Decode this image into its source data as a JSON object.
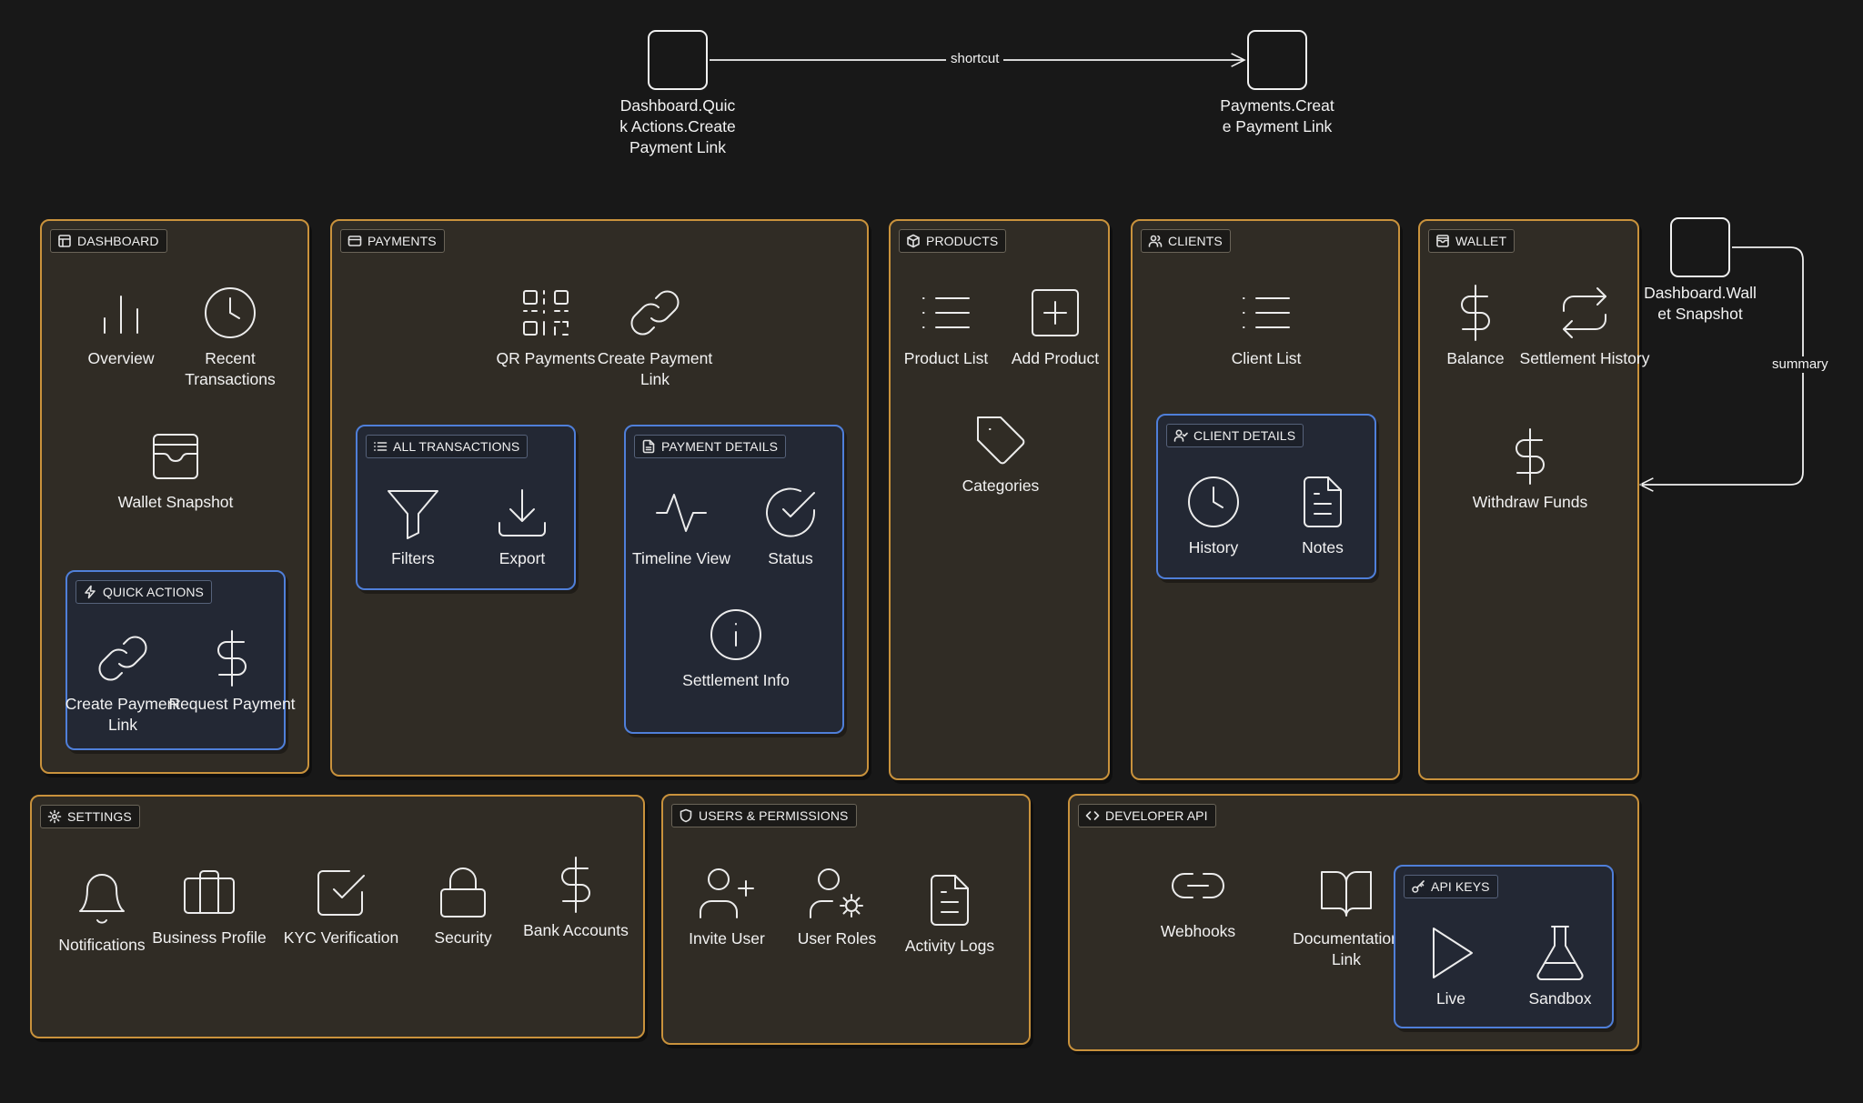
{
  "groups": {
    "dashboard": {
      "label": "DASHBOARD",
      "icon": "layout-icon"
    },
    "quick_actions": {
      "label": "QUICK ACTIONS",
      "icon": "lightning-icon"
    },
    "payments": {
      "label": "PAYMENTS",
      "icon": "card-icon"
    },
    "all_transactions": {
      "label": "ALL TRANSACTIONS",
      "icon": "list-icon"
    },
    "payment_details": {
      "label": "PAYMENT DETAILS",
      "icon": "document-icon"
    },
    "products": {
      "label": "PRODUCTS",
      "icon": "box-icon"
    },
    "clients": {
      "label": "CLIENTS",
      "icon": "users-icon"
    },
    "client_details": {
      "label": "CLIENT DETAILS",
      "icon": "user-check-icon"
    },
    "wallet": {
      "label": "WALLET",
      "icon": "wallet-icon"
    },
    "settings": {
      "label": "SETTINGS",
      "icon": "gear-icon"
    },
    "users_permissions": {
      "label": "USERS & PERMISSIONS",
      "icon": "shield-icon"
    },
    "developer_api": {
      "label": "DEVELOPER API",
      "icon": "code-icon"
    },
    "api_keys": {
      "label": "API KEYS",
      "icon": "key-icon"
    }
  },
  "nodes": {
    "overview": {
      "label": "Overview",
      "icon": "bar-chart-icon"
    },
    "recent_transactions": {
      "label": "Recent Transactions",
      "icon": "clock-icon"
    },
    "wallet_snapshot": {
      "label": "Wallet Snapshot",
      "icon": "wallet-icon"
    },
    "qa_create_payment_link": {
      "label": "Create Payment Link",
      "icon": "link-icon"
    },
    "request_payment": {
      "label": "Request Payment",
      "icon": "dollar-icon"
    },
    "qr_payments": {
      "label": "QR Payments",
      "icon": "qr-code-icon"
    },
    "create_payment_link": {
      "label": "Create Payment Link",
      "icon": "link-icon"
    },
    "filters": {
      "label": "Filters",
      "icon": "filter-icon"
    },
    "export": {
      "label": "Export",
      "icon": "download-icon"
    },
    "timeline_view": {
      "label": "Timeline View",
      "icon": "activity-icon"
    },
    "status": {
      "label": "Status",
      "icon": "check-circle-icon"
    },
    "settlement_info": {
      "label": "Settlement Info",
      "icon": "info-icon"
    },
    "product_list": {
      "label": "Product List",
      "icon": "list-icon"
    },
    "add_product": {
      "label": "Add Product",
      "icon": "plus-square-icon"
    },
    "categories": {
      "label": "Categories",
      "icon": "tag-icon"
    },
    "client_list": {
      "label": "Client List",
      "icon": "list-icon"
    },
    "history": {
      "label": "History",
      "icon": "clock-icon"
    },
    "notes": {
      "label": "Notes",
      "icon": "file-text-icon"
    },
    "balance": {
      "label": "Balance",
      "icon": "dollar-icon"
    },
    "settlement_history": {
      "label": "Settlement History",
      "icon": "repeat-icon"
    },
    "withdraw_funds": {
      "label": "Withdraw Funds",
      "icon": "dollar-icon"
    },
    "notifications": {
      "label": "Notifications",
      "icon": "bell-icon"
    },
    "business_profile": {
      "label": "Business Profile",
      "icon": "briefcase-icon"
    },
    "kyc_verification": {
      "label": "KYC Verification",
      "icon": "check-square-icon"
    },
    "security": {
      "label": "Security",
      "icon": "lock-icon"
    },
    "bank_accounts": {
      "label": "Bank Accounts",
      "icon": "dollar-icon"
    },
    "invite_user": {
      "label": "Invite User",
      "icon": "user-plus-icon"
    },
    "user_roles": {
      "label": "User Roles",
      "icon": "user-cog-icon"
    },
    "activity_logs": {
      "label": "Activity Logs",
      "icon": "file-text-icon"
    },
    "webhooks": {
      "label": "Webhooks",
      "icon": "link-icon"
    },
    "documentation_link": {
      "label": "Documentation Link",
      "icon": "book-open-icon"
    },
    "live": {
      "label": "Live",
      "icon": "play-icon"
    },
    "sandbox": {
      "label": "Sandbox",
      "icon": "flask-icon"
    }
  },
  "reference_nodes": {
    "ref_quick_create": {
      "label": "Dashboard.Quick Actions.Create Payment Link"
    },
    "ref_payments_create": {
      "label": "Payments.Create Payment Link"
    },
    "ref_wallet_snapshot": {
      "label": "Dashboard.Wallet Snapshot"
    }
  },
  "edges": [
    {
      "from": "Dashboard.Quick Actions.Create Payment Link",
      "to": "Payments.Create Payment Link",
      "label": "shortcut"
    },
    {
      "from": "Dashboard.Wallet Snapshot",
      "to": "WALLET",
      "label": "summary"
    }
  ]
}
